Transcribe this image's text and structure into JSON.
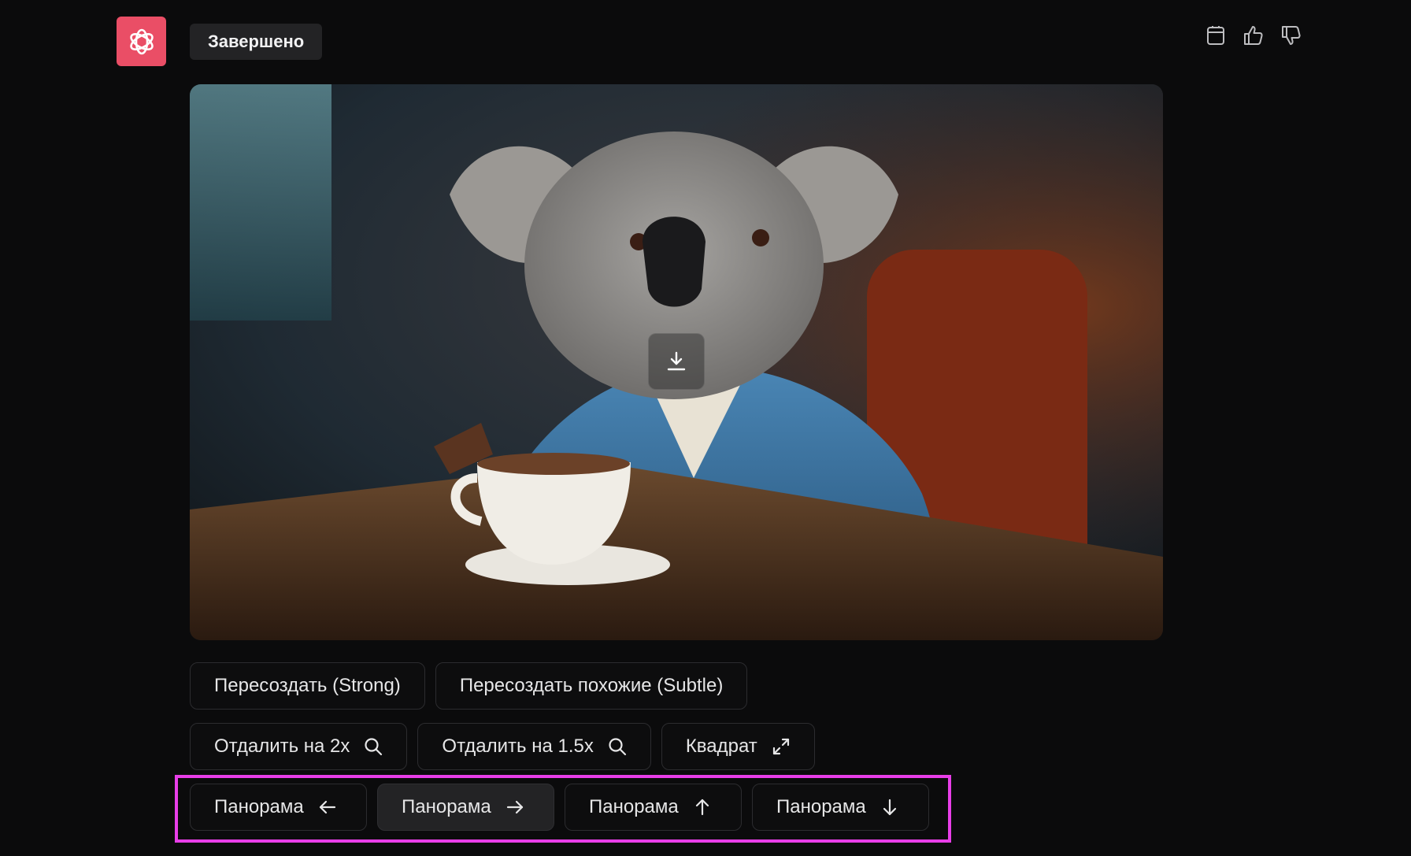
{
  "header": {
    "logo_icon": "openai-logo-icon",
    "status_label": "Завершено",
    "actions": [
      {
        "icon": "copy-icon"
      },
      {
        "icon": "thumbs-up-icon"
      },
      {
        "icon": "thumbs-down-icon"
      }
    ]
  },
  "image": {
    "description_icon": "generated-image",
    "download_icon": "download-icon"
  },
  "buttons": {
    "row1": [
      {
        "label": "Пересоздать (Strong)"
      },
      {
        "label": "Пересоздать похожие (Subtle)"
      }
    ],
    "row2": [
      {
        "label": "Отдалить на 2x",
        "icon": "search-icon"
      },
      {
        "label": "Отдалить на 1.5x",
        "icon": "search-icon"
      },
      {
        "label": "Квадрат",
        "icon": "expand-icon"
      }
    ],
    "row3": [
      {
        "label": "Панорама",
        "icon": "arrow-left-icon"
      },
      {
        "label": "Панорама",
        "icon": "arrow-right-icon",
        "active": true
      },
      {
        "label": "Панорама",
        "icon": "arrow-up-icon"
      },
      {
        "label": "Панорама",
        "icon": "arrow-down-icon"
      }
    ]
  },
  "colors": {
    "background": "#0b0b0c",
    "logo_bg": "#ea4e66",
    "highlight": "#e83ee8",
    "button_border": "#2c2c2f"
  }
}
